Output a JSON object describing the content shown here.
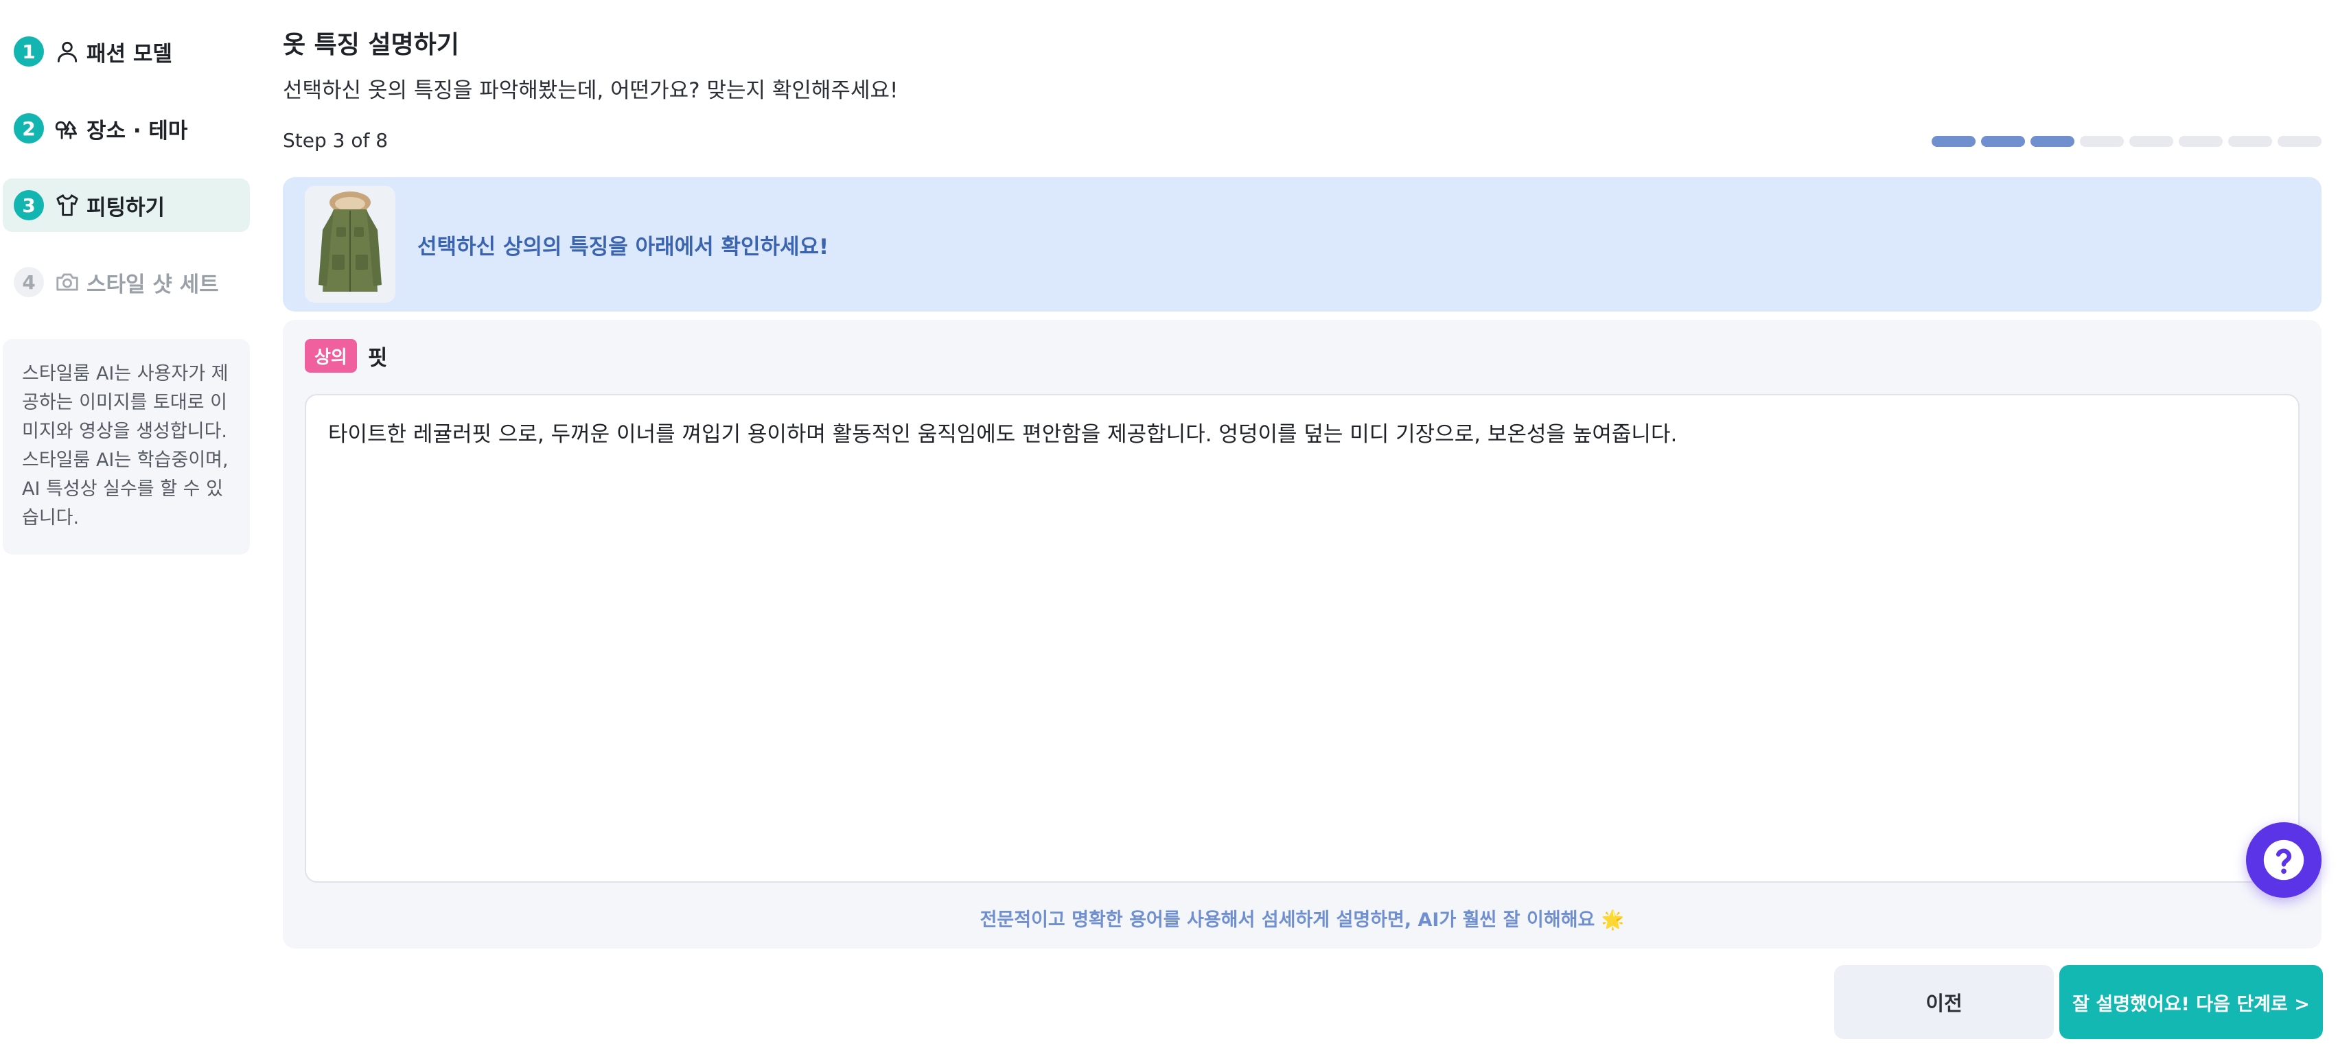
{
  "sidebar": {
    "steps": [
      {
        "num": "1",
        "icon": "person-icon",
        "label": "패션 모델",
        "state": "done"
      },
      {
        "num": "2",
        "icon": "trees-icon",
        "label": "장소 · 테마",
        "state": "done"
      },
      {
        "num": "3",
        "icon": "shirt-icon",
        "label": "피팅하기",
        "state": "active"
      },
      {
        "num": "4",
        "icon": "camera-icon",
        "label": "스타일 샷 세트",
        "state": "disabled"
      }
    ],
    "notice": "스타일룸 AI는 사용자가 제공하는 이미지를 토대로 이미지와 영상을 생성합니다. 스타일룸 AI는 학습중이며, AI 특성상 실수를 할 수 있습니다."
  },
  "header": {
    "title": "옷 특징 설명하기",
    "subtitle": "선택하신 옷의 특징을 파악해봤는데, 어떤가요? 맞는지 확인해주세요!",
    "step_text": "Step 3 of 8",
    "progress": {
      "current": 3,
      "total": 8
    }
  },
  "banner": {
    "text": "선택하신 상의의 특징을 아래에서 확인하세요!",
    "thumb_icon": "parka-jacket-image"
  },
  "field": {
    "tag": "상의",
    "name": "핏",
    "value": "타이트한 레귤러핏 으로, 두꺼운 이너를 껴입기 용이하며 활동적인 움직임에도 편안함을 제공합니다. 엉덩이를 덮는 미디 기장으로, 보온성을 높여줍니다.",
    "hint": "전문적이고 명확한 용어를 사용해서 섬세하게 설명하면, AI가 훨씬 잘 이해해요 🌟"
  },
  "buttons": {
    "prev": "이전",
    "next": "잘 설명했어요! 다음 단계로 >"
  },
  "colors": {
    "accent": "#12b5b0",
    "progress_filled": "#6f8fce",
    "tag": "#f0609e",
    "help": "#5b34e8"
  },
  "help_icon": "question-icon"
}
